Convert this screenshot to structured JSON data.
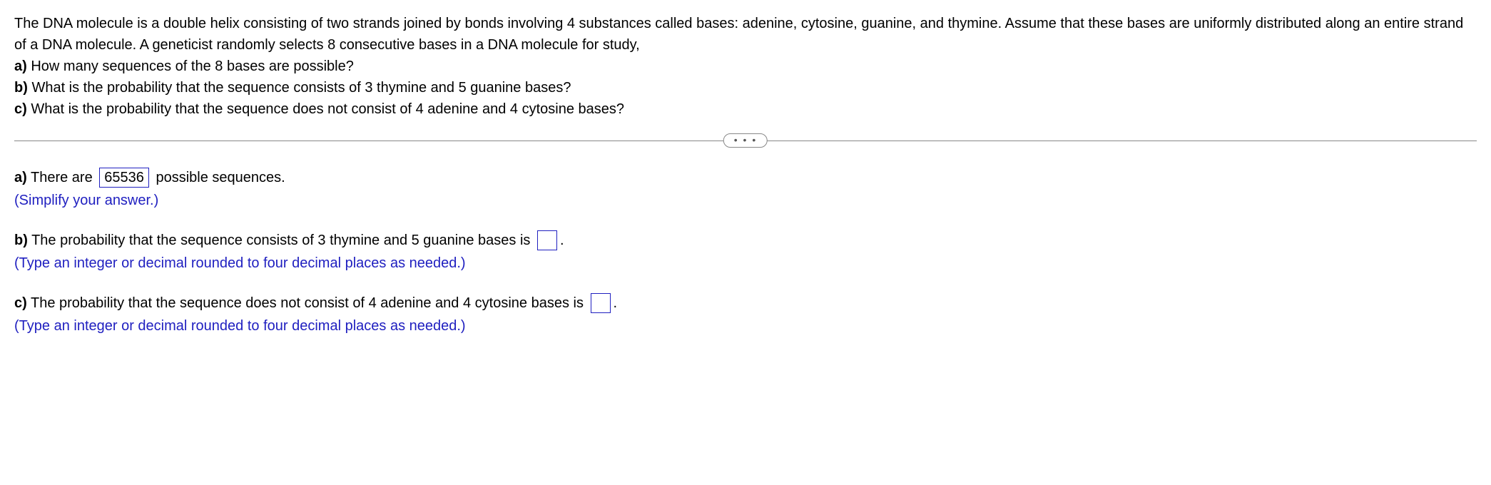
{
  "question": {
    "intro": "The DNA molecule is a double helix consisting of two strands joined by bonds involving 4 substances called bases: adenine, cytosine, guanine, and thymine. Assume that these bases are uniformly distributed along an entire strand of a DNA molecule. A geneticist randomly selects 8 consecutive bases in a DNA molecule for study,",
    "parts": {
      "a": {
        "label": "a)",
        "text": " How many sequences of the 8 bases are possible?"
      },
      "b": {
        "label": "b)",
        "text": " What is the probability that the sequence consists of 3 thymine and 5 guanine bases?"
      },
      "c": {
        "label": "c)",
        "text": " What is the probability that the sequence does not consist of 4 adenine and 4 cytosine bases?"
      }
    }
  },
  "divider": {
    "dots": "• • •"
  },
  "answers": {
    "a": {
      "label": "a)",
      "pre": " There are ",
      "value": "65536",
      "post": " possible sequences.",
      "hint": "(Simplify your answer.)"
    },
    "b": {
      "label": "b)",
      "pre": " The probability that the sequence consists of 3 thymine and 5 guanine bases is ",
      "value": "",
      "post": ".",
      "hint": "(Type an integer or decimal rounded to four decimal places as needed.)"
    },
    "c": {
      "label": "c)",
      "pre": " The probability that the sequence does not consist of 4 adenine and 4 cytosine bases is ",
      "value": "",
      "post": ".",
      "hint": "(Type an integer or decimal rounded to four decimal places as needed.)"
    }
  }
}
